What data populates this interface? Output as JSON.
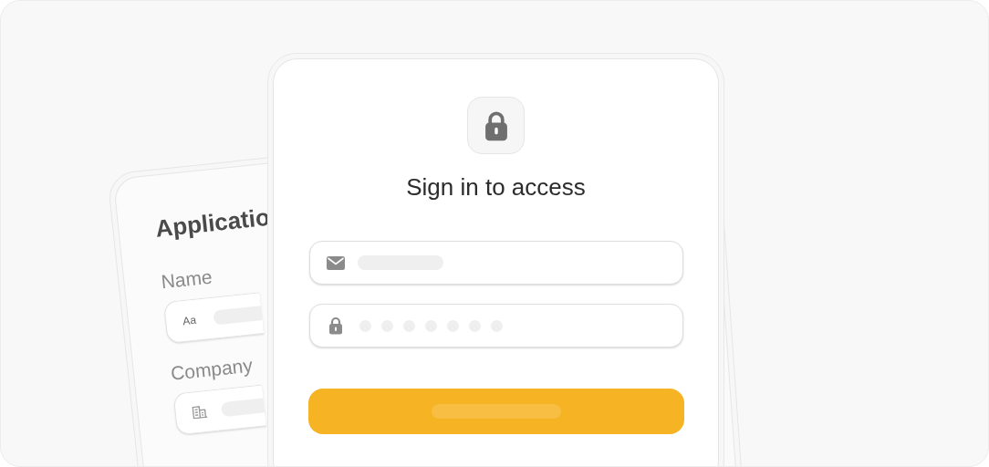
{
  "background_card": {
    "title": "Applicatio",
    "fields": [
      {
        "label": "Name",
        "kind": "text",
        "icon_text": "Aa"
      },
      {
        "label": "Company",
        "kind": "company"
      }
    ]
  },
  "sign_in_card": {
    "title": "Sign in to access",
    "fields": [
      {
        "kind": "email"
      },
      {
        "kind": "password"
      }
    ],
    "button": {
      "kind": "primary"
    }
  }
}
